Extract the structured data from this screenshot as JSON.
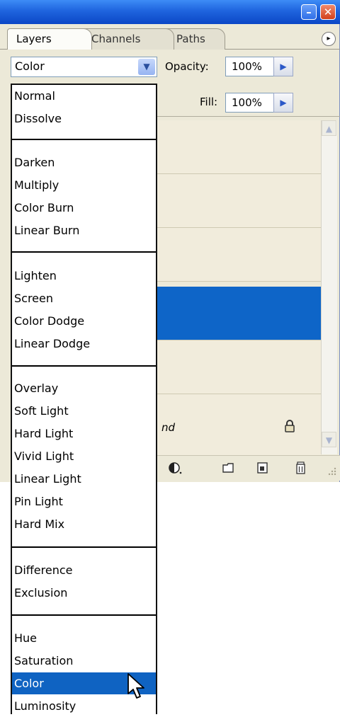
{
  "window": {
    "minimize_glyph": "–",
    "close_glyph": "✕"
  },
  "tabs": [
    {
      "label": "Layers"
    },
    {
      "label": "Channels"
    },
    {
      "label": "Paths"
    }
  ],
  "options": {
    "blend_mode": "Color",
    "opacity_label": "Opacity:",
    "opacity_value": "100%",
    "fill_label": "Fill:",
    "fill_value": "100%"
  },
  "layers": {
    "bottom_layer_text": "nd"
  },
  "blend_menu": {
    "groups": [
      [
        "Normal",
        "Dissolve"
      ],
      [
        "Darken",
        "Multiply",
        "Color Burn",
        "Linear Burn"
      ],
      [
        "Lighten",
        "Screen",
        "Color Dodge",
        "Linear Dodge"
      ],
      [
        "Overlay",
        "Soft Light",
        "Hard Light",
        "Vivid Light",
        "Linear Light",
        "Pin Light",
        "Hard Mix"
      ],
      [
        "Difference",
        "Exclusion"
      ],
      [
        "Hue",
        "Saturation",
        "Color",
        "Luminosity"
      ]
    ],
    "selected": "Color"
  },
  "colors": {
    "title_bar": "#0b47c6",
    "selection": "#0f63c2",
    "panel_bg": "#ece9d8"
  },
  "icons": {
    "minimize": "minimize-icon",
    "close": "close-icon",
    "panel_menu": "panel-menu-icon",
    "lock": "lock-icon",
    "adjustment": "adjustment-layer-icon",
    "group": "folder-icon",
    "new_layer": "new-layer-icon",
    "trash": "trash-icon",
    "cursor": "mouse-cursor-icon"
  }
}
